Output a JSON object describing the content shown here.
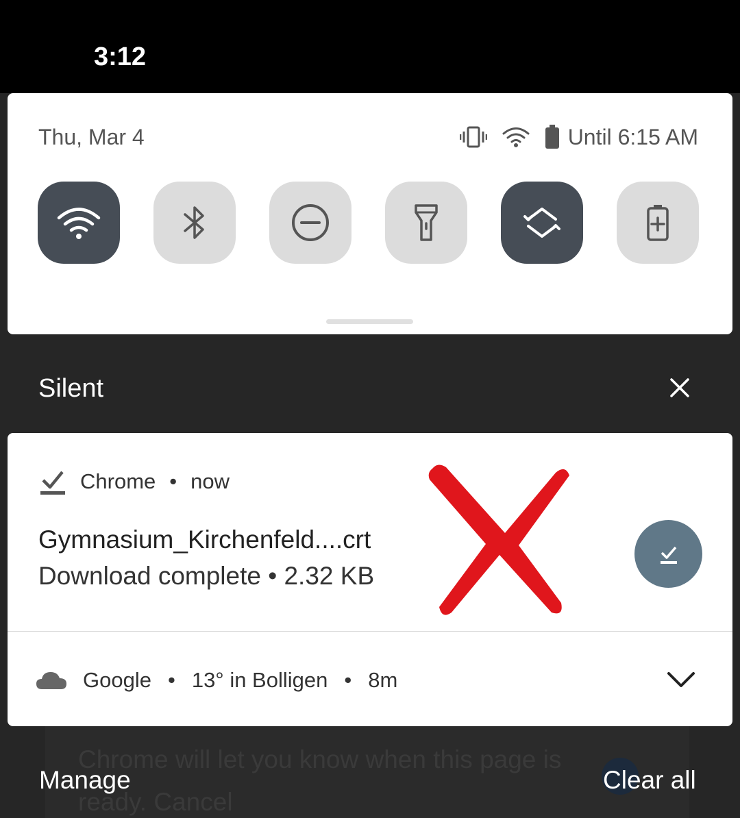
{
  "status_bar": {
    "time": "3:12"
  },
  "quick_settings": {
    "date": "Thu, Mar 4",
    "battery_text": "Until 6:15 AM",
    "tiles": [
      {
        "name": "wifi",
        "icon": "wifi-icon",
        "active": true
      },
      {
        "name": "bluetooth",
        "icon": "bluetooth-icon",
        "active": false
      },
      {
        "name": "do-not-disturb",
        "icon": "do-not-disturb-icon",
        "active": false
      },
      {
        "name": "flashlight",
        "icon": "flashlight-icon",
        "active": false
      },
      {
        "name": "auto-rotate",
        "icon": "auto-rotate-icon",
        "active": true
      },
      {
        "name": "battery-saver",
        "icon": "battery-saver-icon",
        "active": false
      }
    ]
  },
  "section": {
    "title": "Silent"
  },
  "notifications": [
    {
      "app": "Chrome",
      "time": "now",
      "title": "Gymnasium_Kirchenfeld....crt",
      "text": "Download complete • 2.32 KB",
      "icon": "download-done-icon"
    },
    {
      "app": "Google",
      "summary": "13° in Bolligen",
      "time": "8m",
      "icon": "cloud-icon"
    }
  ],
  "background_text": "Chrome will let you know when this page is ready. Cancel",
  "footer": {
    "manage": "Manage",
    "clear_all": "Clear all"
  },
  "colors": {
    "tile_active": "#464d56",
    "tile_inactive": "#dcdcdc",
    "action_button": "#607888",
    "annotation_x": "#e0161c"
  }
}
